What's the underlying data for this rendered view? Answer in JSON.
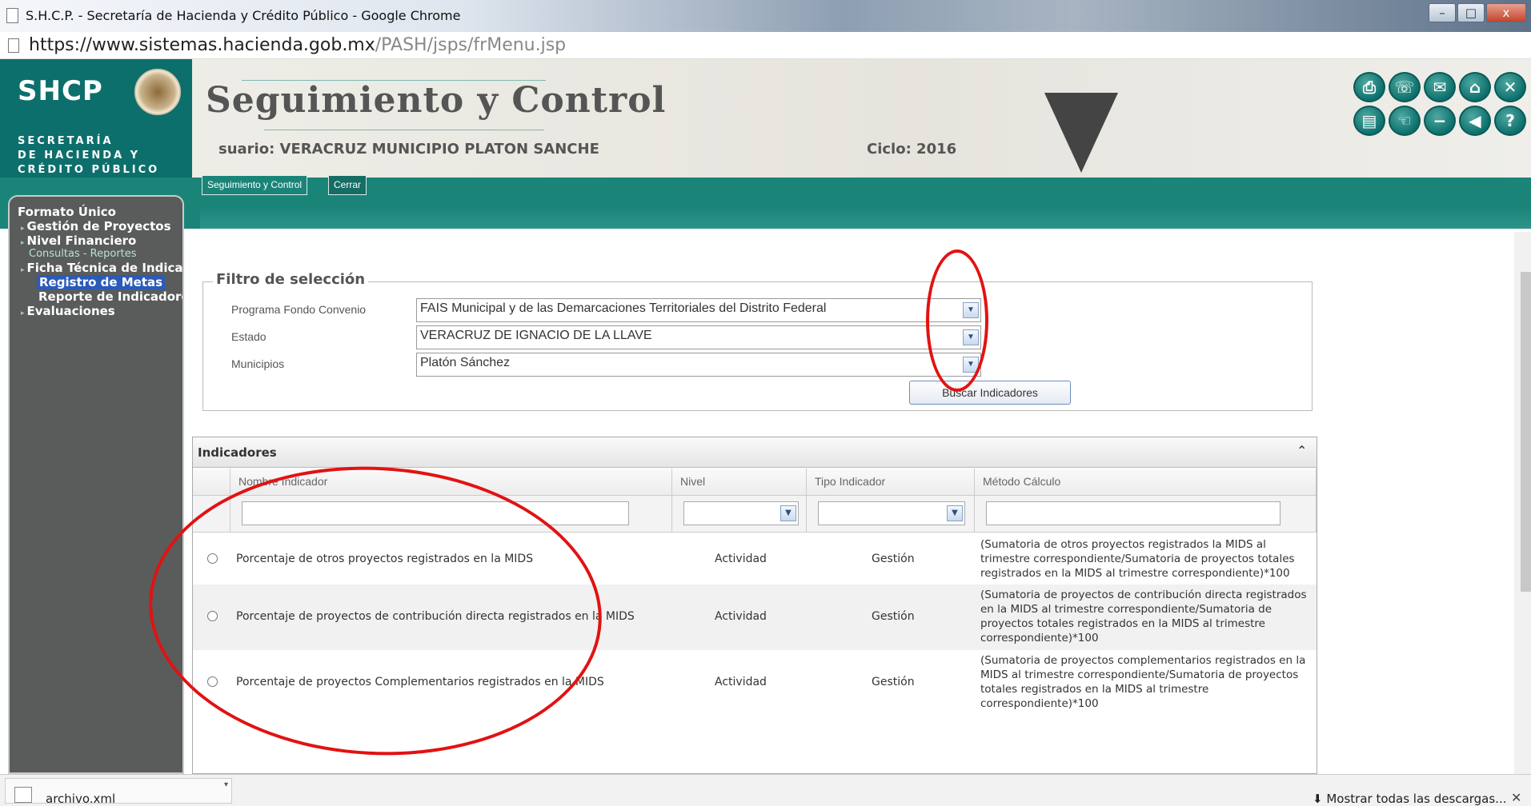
{
  "browser": {
    "window_title": "S.H.C.P. - Secretaría de Hacienda y Crédito Público - Google Chrome",
    "url_host": "https://www.sistemas.hacienda.gob.mx",
    "url_path": "/PASH/jsps/frMenu.jsp",
    "window_buttons": [
      "–",
      "□",
      "x"
    ]
  },
  "header": {
    "logo": "SHCP",
    "logo_sub": [
      "SECRETARÍA",
      "DE HACIENDA Y",
      "CRÉDITO PÚBLICO"
    ],
    "title": "Seguimiento y Control",
    "usuario": "suario: VERACRUZ MUNICIPIO PLATON SANCHE",
    "ciclo": "Ciclo: 2016",
    "icons": [
      "printer-icon",
      "phone-icon",
      "mail-icon",
      "home-icon",
      "close-icon",
      "clipboard-icon",
      "hand-icon",
      "minus-icon",
      "back-icon",
      "help-icon"
    ]
  },
  "tabs": [
    "Seguimiento y Control",
    "Cerrar"
  ],
  "sidebar": {
    "items": [
      {
        "label": "Formato Único",
        "type": "main"
      },
      {
        "label": "Gestión de Proyectos",
        "type": "main"
      },
      {
        "label": "Nivel Financiero",
        "type": "main"
      },
      {
        "label": "Consultas - Reportes",
        "type": "sub"
      },
      {
        "label": "Ficha Técnica de Indicadores",
        "type": "main"
      },
      {
        "label": "Registro de Metas",
        "type": "active"
      },
      {
        "label": "Reporte de Indicadores",
        "type": "main"
      },
      {
        "label": "Evaluaciones",
        "type": "main"
      }
    ]
  },
  "filtro": {
    "legend": "Filtro de selección",
    "programa_label": "Programa Fondo Convenio",
    "programa_value": "FAIS Municipal y de las Demarcaciones Territoriales del Distrito Federal",
    "estado_label": "Estado",
    "estado_value": "VERACRUZ DE IGNACIO DE LA LLAVE",
    "municipios_label": "Municipios",
    "municipios_value": "Platón Sánchez",
    "buscar_label": "Buscar Indicadores"
  },
  "indicadores": {
    "caption": "Indicadores",
    "columns": [
      "Nombre Indicador",
      "Nivel",
      "Tipo Indicador",
      "Método Cálculo"
    ],
    "rows": [
      {
        "nombre": "Porcentaje de otros proyectos registrados en la MIDS",
        "nivel": "Actividad",
        "tipo": "Gestión",
        "metodo": "(Sumatoria de otros proyectos registrados la MIDS al trimestre correspondiente/Sumatoria de proyectos totales registrados en la MIDS al trimestre correspondiente)*100"
      },
      {
        "nombre": "Porcentaje de proyectos de contribución directa registrados en la MIDS",
        "nivel": "Actividad",
        "tipo": "Gestión",
        "metodo": "(Sumatoria de proyectos de contribución directa registrados en la MIDS al trimestre correspondiente/Sumatoria de proyectos totales registrados en la MIDS al trimestre correspondiente)*100"
      },
      {
        "nombre": "Porcentaje de proyectos Complementarios registrados en la MIDS",
        "nivel": "Actividad",
        "tipo": "Gestión",
        "metodo": "(Sumatoria de proyectos complementarios registrados en la MIDS al trimestre correspondiente/Sumatoria de proyectos totales registrados en la MIDS al trimestre correspondiente)*100"
      }
    ]
  },
  "downloads": {
    "file": "archivo.xml",
    "show_all": "Mostrar todas las descargas..."
  }
}
